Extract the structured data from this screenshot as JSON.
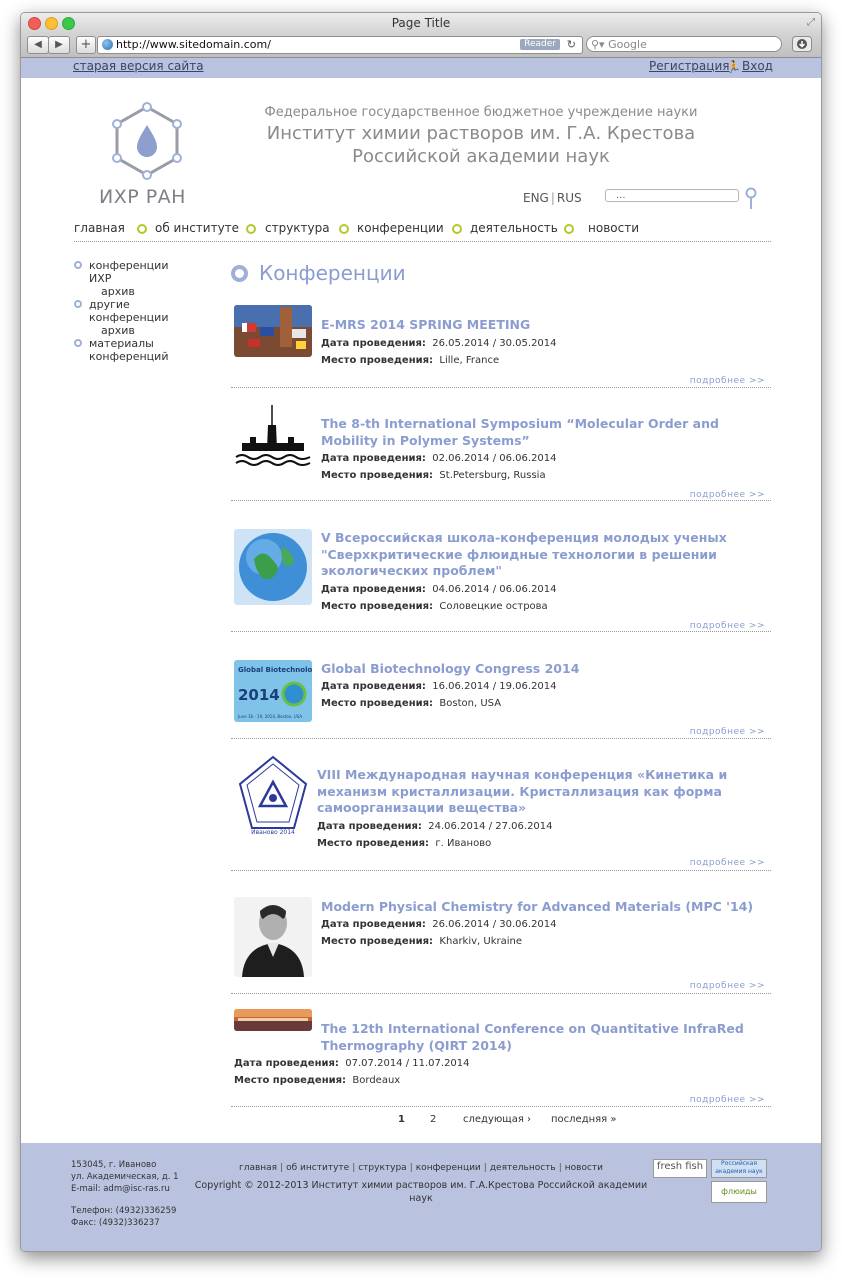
{
  "browser": {
    "window_title": "Page Title",
    "url": "http://www.sitedomain.com/",
    "reader_label": "Reader",
    "search_placeholder": "Google",
    "add_tab": "+",
    "back": "◀",
    "forward": "▶"
  },
  "topbar": {
    "old_version": "старая версия сайта",
    "register": "Регистрация",
    "login": "Вход"
  },
  "header": {
    "logo_text": "ИХР РАН",
    "subtitle": "Федеральное государственное бюджетное учреждение науки",
    "name_line1": "Институт химии растворов им. Г.А. Крестова",
    "name_line2": "Российской академии наук",
    "lang_eng": "ENG",
    "lang_rus": "RUS",
    "search_value": "..."
  },
  "nav": [
    {
      "label": "главная"
    },
    {
      "label": "об институте"
    },
    {
      "label": "структура"
    },
    {
      "label": "конференции"
    },
    {
      "label": "деятельность"
    },
    {
      "label": "новости"
    }
  ],
  "sidebar": [
    {
      "label": "конференции ИХР",
      "sub": "архив"
    },
    {
      "label": "другие конференции",
      "sub": "архив"
    },
    {
      "label": "материалы конференций",
      "sub": ""
    }
  ],
  "page_title": "Конференции",
  "labels": {
    "date": "Дата проведения:",
    "place": "Место проведения:",
    "more": "подробнее >>"
  },
  "conferences": [
    {
      "title": "E-MRS 2014 SPRING MEETING",
      "date": "26.05.2014 / 30.05.2014",
      "place": "Lille, France",
      "thumb": "flags-photo"
    },
    {
      "title": "The 8-th International Symposium “Molecular Order and Mobility in Polymer Systems”",
      "date": "02.06.2014 / 06.06.2014",
      "place": "St.Petersburg, Russia",
      "thumb": "spire-logo"
    },
    {
      "title": "V Всероссийская школа-конференция молодых ученых \"Сверхкритические флюидные технологии в решении экологических проблем\"",
      "date": "04.06.2014 / 06.06.2014",
      "place": "Соловецкие острова",
      "thumb": "globe-image"
    },
    {
      "title": "Global Biotechnology Congress 2014",
      "date": "16.06.2014 / 19.06.2014",
      "place": "Boston, USA",
      "thumb": "biotech-logo",
      "thumb_text_1": "Global Biotechnology Congress",
      "thumb_text_2": "2014",
      "thumb_text_3": "June 16 - 19, 2014, Boston, USA"
    },
    {
      "title": "VIII Международная научная конференция «Кинетика и механизм кристаллизации. Кристаллизация как форма самоорганизации вещества»",
      "date": "24.06.2014 / 27.06.2014",
      "place": "г. Иваново",
      "thumb": "crystal-logo",
      "thumb_text": "Иваново 2014"
    },
    {
      "title": "Modern Physical Chemistry for Advanced Materials (MPC '14)",
      "date": "26.06.2014 / 30.06.2014",
      "place": "Kharkiv, Ukraine",
      "thumb": "portrait-photo"
    },
    {
      "title": "The 12th International Conference on Quantitative InfraRed Thermography (QIRT 2014)",
      "date": "07.07.2014 / 11.07.2014",
      "place": "Bordeaux",
      "thumb": "city-panorama"
    }
  ],
  "pager": {
    "page1": "1",
    "page2": "2",
    "next": "следующая ›",
    "last": "последняя »"
  },
  "footer": {
    "addr1": "153045, г. Иваново",
    "addr2": "ул. Академическая, д. 1",
    "email": "E-mail: adm@isc-ras.ru",
    "phone": "Телефон: (4932)336259",
    "fax": "Факс: (4932)336237",
    "nav": [
      "главная",
      "об институте",
      "структура",
      "конференции",
      "деятельность",
      "новости"
    ],
    "copyright": "Copyright © 2012-2013  Институт химии растворов им. Г.А.Крестова Российской академии наук",
    "badge1": "fresh fish",
    "badge2": "Российская академия наук",
    "badge3": "флюиды"
  },
  "colors": {
    "accent": "#8b9dd0",
    "bar": "#b9c3e0",
    "nav_dot": "#b6c62d"
  }
}
